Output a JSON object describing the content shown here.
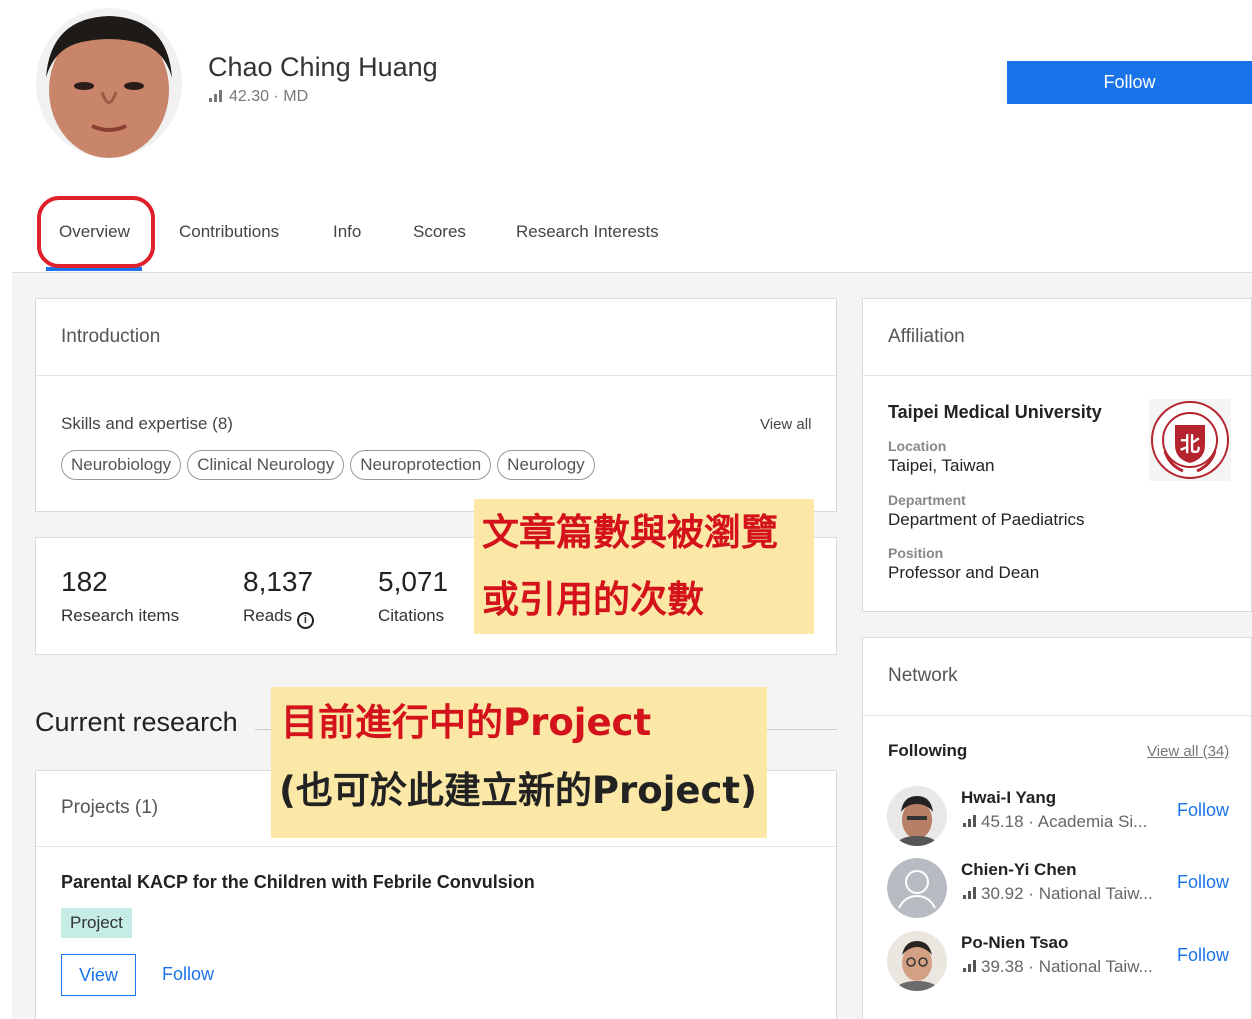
{
  "profile": {
    "name": "Chao Ching Huang",
    "score": "42.30",
    "separator": "·",
    "degree": "MD",
    "follow_label": "Follow"
  },
  "tabs": [
    {
      "label": "Overview",
      "active": true
    },
    {
      "label": "Contributions"
    },
    {
      "label": "Info"
    },
    {
      "label": "Scores"
    },
    {
      "label": "Research Interests"
    }
  ],
  "introduction": {
    "title": "Introduction",
    "skills_title": "Skills and expertise (8)",
    "view_all": "View all",
    "skills": [
      "Neurobiology",
      "Clinical Neurology",
      "Neuroprotection",
      "Neurology"
    ]
  },
  "stats": [
    {
      "value": "182",
      "label": "Research items"
    },
    {
      "value": "8,137",
      "label": "Reads"
    },
    {
      "value": "5,071",
      "label": "Citations"
    }
  ],
  "annotations": {
    "stats_note_line1": "文章篇數與被瀏覽",
    "stats_note_line2": "或引用的次數",
    "project_note_line1": "目前進行中的Project",
    "project_note_line2": "(也可於此建立新的Project)"
  },
  "current_research": {
    "title": "Current research",
    "projects_title": "Projects (1)",
    "project_name": "Parental KACP for the Children with Febrile Convulsion",
    "badge": "Project",
    "view_label": "View",
    "follow_label": "Follow"
  },
  "affiliation": {
    "title": "Affiliation",
    "institution": "Taipei Medical University",
    "location_label": "Location",
    "location": "Taipei, Taiwan",
    "department_label": "Department",
    "department": "Department of Paediatrics",
    "position_label": "Position",
    "position": "Professor and Dean",
    "logo_text": "TAIPEI MEDICAL UNIVERSITY"
  },
  "network": {
    "title": "Network",
    "following_label": "Following",
    "view_all": "View all (34)",
    "people": [
      {
        "name": "Hwai-I Yang",
        "score": "45.18",
        "org": "Academia Si...",
        "follow": "Follow"
      },
      {
        "name": "Chien-Yi Chen",
        "score": "30.92",
        "org": "National Taiw...",
        "follow": "Follow"
      },
      {
        "name": "Po-Nien Tsao",
        "score": "39.38",
        "org": "National Taiw...",
        "follow": "Follow"
      }
    ]
  },
  "colors": {
    "accent": "#1a73e8",
    "highlight_red": "#e0202a",
    "note_bg": "#fbe8a6",
    "note_text": "#d4121b",
    "badge_bg": "#c5ece5"
  }
}
